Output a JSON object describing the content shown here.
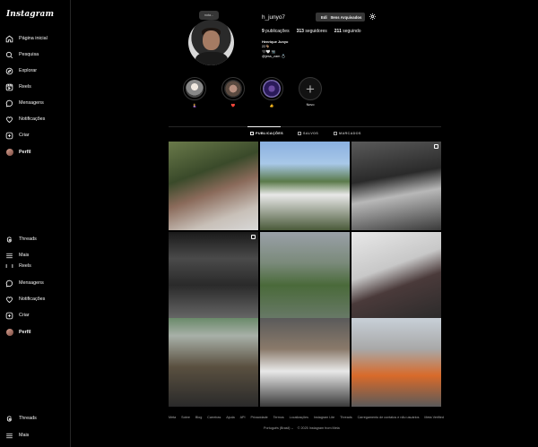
{
  "app": {
    "logo": "Instagram"
  },
  "sidebar": {
    "items": [
      {
        "label": "Página inicial",
        "icon": "home-icon"
      },
      {
        "label": "Pesquisa",
        "icon": "search-icon"
      },
      {
        "label": "Explorar",
        "icon": "compass-icon"
      },
      {
        "label": "Reels",
        "icon": "reels-icon"
      },
      {
        "label": "Mensagens",
        "icon": "messenger-icon"
      },
      {
        "label": "Notificações",
        "icon": "heart-icon"
      },
      {
        "label": "Criar",
        "icon": "plus-square-icon"
      },
      {
        "label": "Perfil",
        "icon": "avatar"
      },
      {
        "label": "Threads",
        "icon": "threads-icon"
      },
      {
        "label": "Mais",
        "icon": "menu-icon"
      },
      {
        "label": "Reels",
        "icon": "reels-icon"
      },
      {
        "label": "Mensagens",
        "icon": "messenger-icon"
      },
      {
        "label": "Notificações",
        "icon": "heart-icon"
      },
      {
        "label": "Criar",
        "icon": "plus-square-icon"
      },
      {
        "label": "Perfil",
        "icon": "avatar"
      },
      {
        "label": "Threads",
        "icon": "threads-icon"
      },
      {
        "label": "Mais",
        "icon": "menu-icon"
      }
    ]
  },
  "profile": {
    "note": "nota...",
    "username": "h_junyo7",
    "edit_label": "Editar perfil",
    "archive_label": "Itens Arquivados",
    "stats": {
      "posts_count": "9",
      "posts_label": "publicações",
      "followers_count": "313",
      "followers_label": "seguidores",
      "following_count": "211",
      "following_label": "seguindo"
    },
    "bio": {
      "name": "Henrique Junyo",
      "line1": "22🐐",
      "line2": "🖤🤍 📷",
      "line3": "@jess_zam 💍"
    }
  },
  "highlights": [
    {
      "label": "🤱"
    },
    {
      "label": "❤️"
    },
    {
      "label": "👍"
    },
    {
      "label": "Novo"
    }
  ],
  "tabs": [
    {
      "label": "PUBLICAÇÕES"
    },
    {
      "label": "SALVOS"
    },
    {
      "label": "MARCADOS"
    }
  ],
  "footer": {
    "links": [
      "Meta",
      "Sobre",
      "Blog",
      "Carreiras",
      "Ajuda",
      "API",
      "Privacidade",
      "Termos",
      "Localizações",
      "Instagram Lite",
      "Threads",
      "Carregamento de contatos e não usuários",
      "Meta Verified"
    ],
    "language": "Português (Brasil) ⌄",
    "copyright": "© 2025 Instagram from Meta"
  },
  "colors": {
    "background": "#000000",
    "button": "#363636",
    "secondary_text": "#a8a8a8",
    "divider": "#262626"
  }
}
